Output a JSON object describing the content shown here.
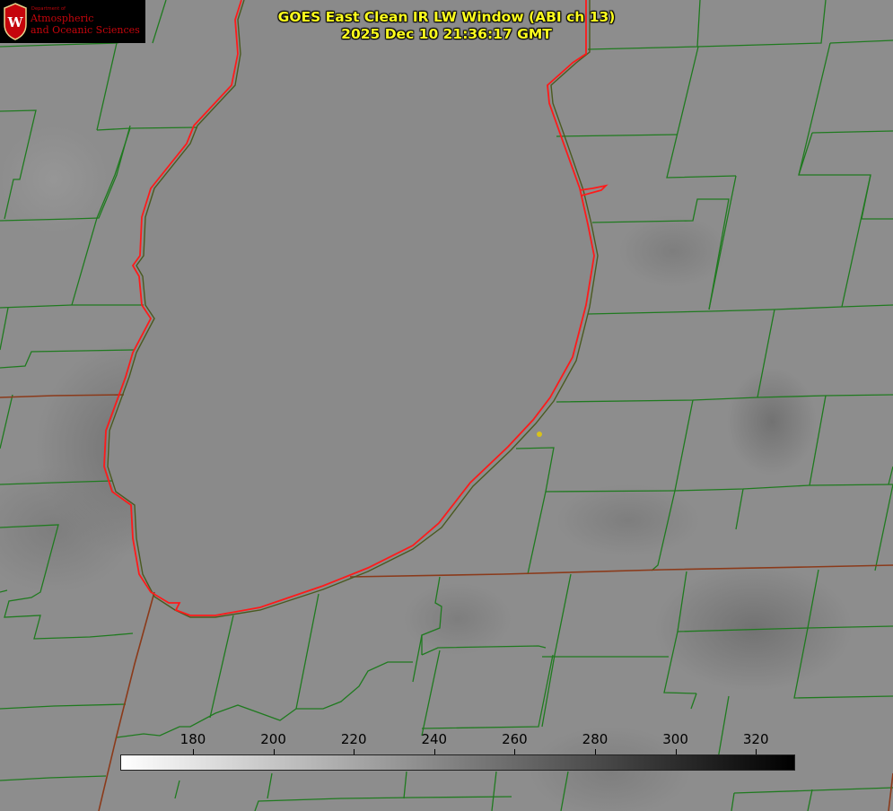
{
  "title": {
    "line1": "GOES East Clean IR LW Window (ABI ch 13)",
    "line2": "2025 Dec 10 21:36:17 GMT"
  },
  "logo": {
    "department": "Department of",
    "line1": "Atmospheric",
    "line2": "and Oceanic Sciences",
    "emblem_letter": "W"
  },
  "colors": {
    "background_gray": "#8e8e8e",
    "county_lines": "#1f7a1f",
    "lake_outline": "#ff1a1a",
    "state_lines": "#8b3a1a",
    "title_text": "#ffff1e",
    "marker": "#d8c21a"
  },
  "colorbar": {
    "ticks": [
      "180",
      "200",
      "220",
      "240",
      "260",
      "280",
      "300",
      "320"
    ],
    "gradient_from": "#ffffff",
    "gradient_to": "#000000"
  }
}
